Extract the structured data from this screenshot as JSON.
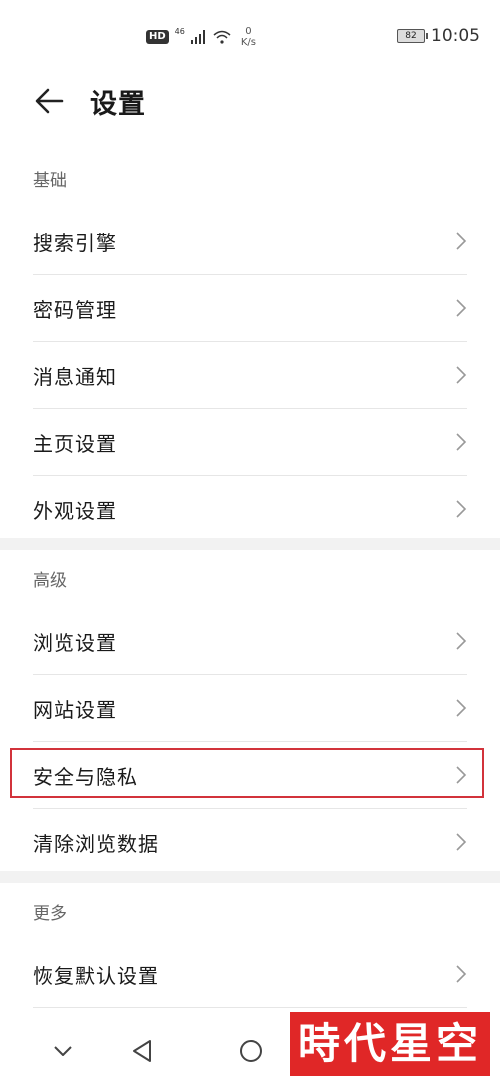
{
  "status_bar": {
    "hd": "HD",
    "network": "46",
    "speed_value": "0",
    "speed_unit": "K/s",
    "battery": "82",
    "time": "10:05"
  },
  "header": {
    "title": "设置"
  },
  "sections": [
    {
      "title": "基础",
      "items": [
        "搜索引擎",
        "密码管理",
        "消息通知",
        "主页设置",
        "外观设置"
      ]
    },
    {
      "title": "高级",
      "items": [
        "浏览设置",
        "网站设置",
        "安全与隐私",
        "清除浏览数据"
      ]
    },
    {
      "title": "更多",
      "items": [
        "恢复默认设置"
      ]
    }
  ],
  "watermark": "時代星空",
  "colors": {
    "highlight": "#d2333b",
    "watermark_bg": "#e02727",
    "band": "#f2f2f2"
  }
}
